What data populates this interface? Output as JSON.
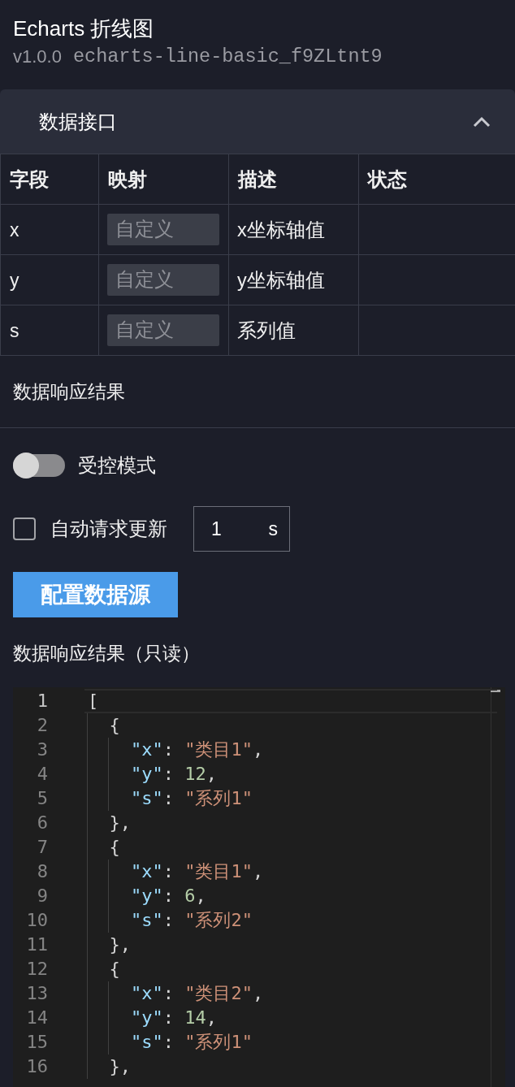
{
  "header": {
    "title": "Echarts 折线图",
    "version": "v1.0.0",
    "component_id": "echarts-line-basic_f9ZLtnt9"
  },
  "data_interface": {
    "title": "数据接口",
    "expanded": true,
    "table": {
      "columns": [
        "字段",
        "映射",
        "描述",
        "状态"
      ],
      "rows": [
        {
          "field": "x",
          "mapping": {
            "placeholder": "自定义"
          },
          "description": "x坐标轴值"
        },
        {
          "field": "y",
          "mapping": {
            "placeholder": "自定义"
          },
          "description": "y坐标轴值"
        },
        {
          "field": "s",
          "mapping": {
            "placeholder": "自定义"
          },
          "description": "系列值"
        }
      ]
    }
  },
  "response_section": {
    "title": "数据响应结果"
  },
  "controlled_mode": {
    "label": "受控模式",
    "on": false
  },
  "auto_refresh": {
    "label": "自动请求更新",
    "checked": false,
    "interval": {
      "value": "1",
      "unit": "s"
    }
  },
  "config_button": {
    "label": "配置数据源"
  },
  "readonly_result": {
    "title": "数据响应结果（只读）",
    "editor": {
      "lines": [
        {
          "number": "1",
          "current": true,
          "tokens": [
            {
              "kind": "punct",
              "text": "["
            }
          ]
        },
        {
          "number": "2",
          "current": false,
          "tokens": [
            {
              "kind": "punct",
              "text": "  {"
            }
          ]
        },
        {
          "number": "3",
          "current": false,
          "tokens": [
            {
              "kind": "key",
              "text": "    \"x\""
            },
            {
              "kind": "punct",
              "text": ": "
            },
            {
              "kind": "string",
              "text": "\"类目1\""
            },
            {
              "kind": "punct",
              "text": ","
            }
          ]
        },
        {
          "number": "4",
          "current": false,
          "tokens": [
            {
              "kind": "key",
              "text": "    \"y\""
            },
            {
              "kind": "punct",
              "text": ": "
            },
            {
              "kind": "number",
              "text": "12"
            },
            {
              "kind": "punct",
              "text": ","
            }
          ]
        },
        {
          "number": "5",
          "current": false,
          "tokens": [
            {
              "kind": "key",
              "text": "    \"s\""
            },
            {
              "kind": "punct",
              "text": ": "
            },
            {
              "kind": "string",
              "text": "\"系列1\""
            }
          ]
        },
        {
          "number": "6",
          "current": false,
          "tokens": [
            {
              "kind": "punct",
              "text": "  },"
            }
          ]
        },
        {
          "number": "7",
          "current": false,
          "tokens": [
            {
              "kind": "punct",
              "text": "  {"
            }
          ]
        },
        {
          "number": "8",
          "current": false,
          "tokens": [
            {
              "kind": "key",
              "text": "    \"x\""
            },
            {
              "kind": "punct",
              "text": ": "
            },
            {
              "kind": "string",
              "text": "\"类目1\""
            },
            {
              "kind": "punct",
              "text": ","
            }
          ]
        },
        {
          "number": "9",
          "current": false,
          "tokens": [
            {
              "kind": "key",
              "text": "    \"y\""
            },
            {
              "kind": "punct",
              "text": ": "
            },
            {
              "kind": "number",
              "text": "6"
            },
            {
              "kind": "punct",
              "text": ","
            }
          ]
        },
        {
          "number": "10",
          "current": false,
          "tokens": [
            {
              "kind": "key",
              "text": "    \"s\""
            },
            {
              "kind": "punct",
              "text": ": "
            },
            {
              "kind": "string",
              "text": "\"系列2\""
            }
          ]
        },
        {
          "number": "11",
          "current": false,
          "tokens": [
            {
              "kind": "punct",
              "text": "  },"
            }
          ]
        },
        {
          "number": "12",
          "current": false,
          "tokens": [
            {
              "kind": "punct",
              "text": "  {"
            }
          ]
        },
        {
          "number": "13",
          "current": false,
          "tokens": [
            {
              "kind": "key",
              "text": "    \"x\""
            },
            {
              "kind": "punct",
              "text": ": "
            },
            {
              "kind": "string",
              "text": "\"类目2\""
            },
            {
              "kind": "punct",
              "text": ","
            }
          ]
        },
        {
          "number": "14",
          "current": false,
          "tokens": [
            {
              "kind": "key",
              "text": "    \"y\""
            },
            {
              "kind": "punct",
              "text": ": "
            },
            {
              "kind": "number",
              "text": "14"
            },
            {
              "kind": "punct",
              "text": ","
            }
          ]
        },
        {
          "number": "15",
          "current": false,
          "tokens": [
            {
              "kind": "key",
              "text": "    \"s\""
            },
            {
              "kind": "punct",
              "text": ": "
            },
            {
              "kind": "string",
              "text": "\"系列1\""
            }
          ]
        },
        {
          "number": "16",
          "current": false,
          "tokens": [
            {
              "kind": "punct",
              "text": "  },"
            }
          ]
        }
      ]
    }
  }
}
